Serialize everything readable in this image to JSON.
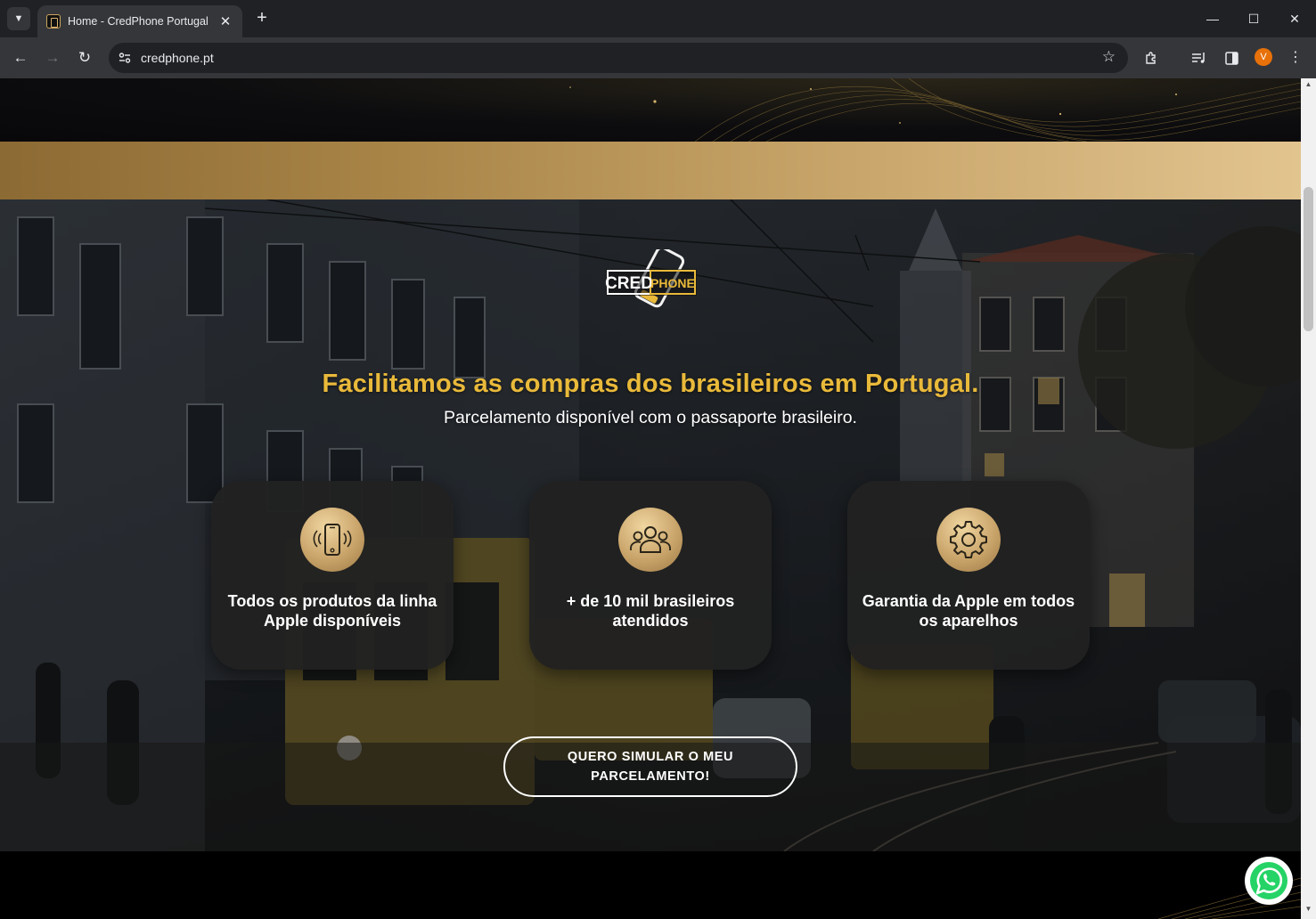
{
  "browser": {
    "tab_title": "Home - CredPhone Portugal",
    "url": "credphone.pt",
    "profile_initial": "V",
    "icons": {
      "tab_search": "chevron-down-icon",
      "close_tab": "close-icon",
      "new_tab": "plus-icon",
      "back": "arrow-left-icon",
      "forward": "arrow-right-icon",
      "reload": "reload-icon",
      "site_info": "tune-icon",
      "bookmark": "star-icon",
      "extensions": "puzzle-icon",
      "media": "media-queue-icon",
      "side_panel": "side-panel-icon",
      "menu": "kebab-menu-icon"
    }
  },
  "hero": {
    "logo_text": "CREDPHONE",
    "headline": "Facilitamos as compras dos brasileiros em Portugal.",
    "subline": "Parcelamento disponível com o passaporte brasileiro.",
    "features": [
      {
        "icon": "smartphone-icon",
        "text": "Todos os produtos da linha Apple disponíveis"
      },
      {
        "icon": "users-group-icon",
        "text": "+ de 10 mil brasileiros atendidos"
      },
      {
        "icon": "gear-icon",
        "text": "Garantia da Apple em todos os aparelhos"
      }
    ],
    "cta_label": "QUERO SIMULAR O MEU PARCELAMENTO!"
  },
  "colors": {
    "accent_gold": "#e9b93a",
    "band_gold_start": "#8c6a33",
    "band_gold_end": "#e2c48f",
    "card_bg": "#212121",
    "whatsapp_green": "#25d366"
  },
  "floating": {
    "whatsapp_icon": "whatsapp-icon"
  }
}
